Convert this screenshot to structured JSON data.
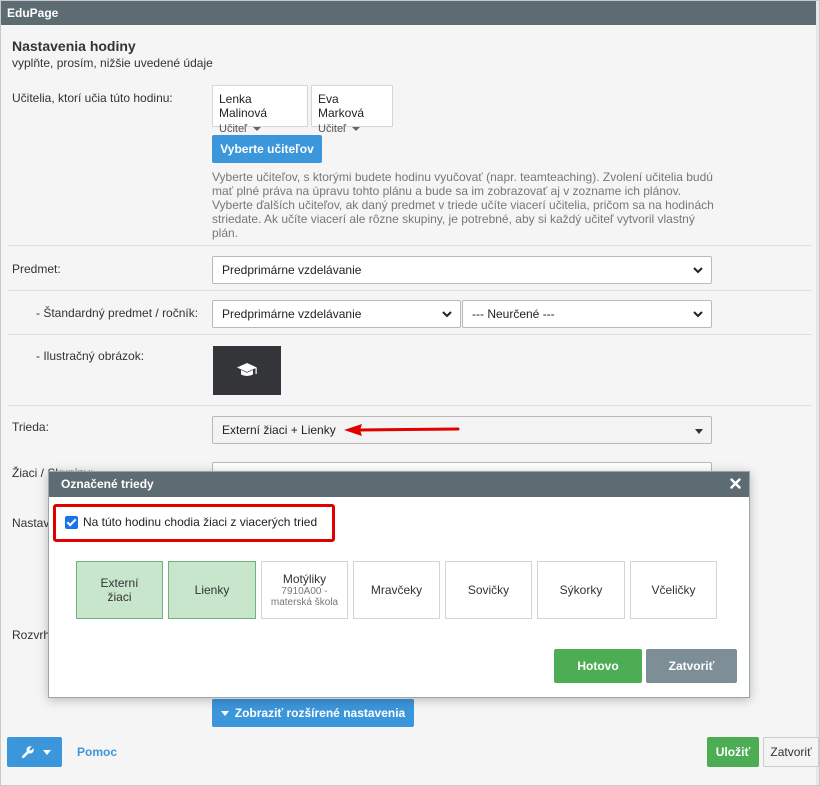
{
  "app": {
    "title": "EduPage"
  },
  "page": {
    "title": "Nastavenia hodiny",
    "subtitle": "vyplňte, prosím, nižšie uvedené údaje"
  },
  "teachers": {
    "label": "Učitelia, ktorí učia túto hodinu:",
    "cards": [
      {
        "name": "Lenka Malinová",
        "role": "Učiteľ"
      },
      {
        "name": "Eva Marková",
        "role": "Učiteľ"
      }
    ],
    "select_button": "Vyberte učiteľov",
    "help": "Vyberte učiteľov, s ktorými budete hodinu vyučovať (napr. teamteaching). Zvolení učitelia budú mať plné práva na úpravu tohto plánu a bude sa im zobrazovať aj v zozname ich plánov. Vyberte ďalších učiteľov, ak daný predmet v triede učíte viacerí učitelia, pričom sa na hodinách striedate. Ak učíte viacerí ale rôzne skupiny, je potrebné, aby si každý učiteľ vytvoril vlastný plán."
  },
  "subject": {
    "label": "Predmet:",
    "value": "Predprimárne vzdelávanie"
  },
  "standard": {
    "label": "- Štandardný predmet / ročník:",
    "subject_value": "Predprimárne vzdelávanie",
    "grade_value": "--- Neurčené ---"
  },
  "illustration": {
    "label": "- Ilustračný obrázok:"
  },
  "class_field": {
    "label": "Trieda:",
    "value": "Externí žiaci + Lienky"
  },
  "covered_labels": {
    "students": "Žiaci / Skupiny:",
    "settings": "Nastavenia:",
    "schedule": "Rozvrh:"
  },
  "advanced_button": "Zobraziť rozšírené nastavenia",
  "footer": {
    "help_link": "Pomoc",
    "save": "Uložiť",
    "close": "Zatvoriť"
  },
  "dialog": {
    "title": "Označené triedy",
    "multi_class_checkbox": "Na túto hodinu chodia žiaci z viacerých tried",
    "classes": [
      {
        "main": "Externí žiaci",
        "sub": "",
        "selected": true
      },
      {
        "main": "Lienky",
        "sub": "",
        "selected": true
      },
      {
        "main": "Motýliky",
        "sub": "7910A00 - materská škola",
        "selected": false
      },
      {
        "main": "Mravčeky",
        "sub": "",
        "selected": false
      },
      {
        "main": "Sovičky",
        "sub": "",
        "selected": false
      },
      {
        "main": "Sýkorky",
        "sub": "",
        "selected": false
      },
      {
        "main": "Včeličky",
        "sub": "",
        "selected": false
      }
    ],
    "done_button": "Hotovo",
    "close_button": "Zatvoriť"
  },
  "colors": {
    "header": "#5d6b73",
    "primary": "#3c96db",
    "success": "#4cad55",
    "selected_tile": "#c8e6cc",
    "highlight": "#e00000"
  }
}
